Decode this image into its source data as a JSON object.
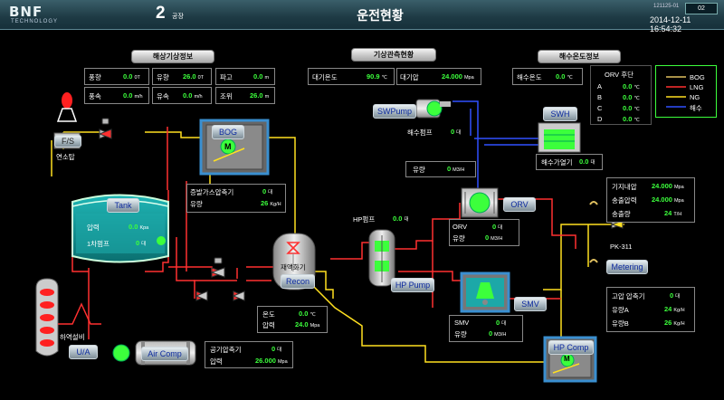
{
  "header": {
    "logo": "BNF",
    "logo_sub": "TECHNOLOGY",
    "plant_number": "2",
    "plant_label": "공장",
    "title": "운전현황",
    "system_id": "121125-01",
    "system_num": "02",
    "datetime": "2014-12-11  16:54:32"
  },
  "sections": {
    "sea_weather": "해상기상정보",
    "air_weather": "기상관측현황",
    "sea_temp": "해수온도정보"
  },
  "sea_weather": [
    {
      "label": "풍향",
      "value": "0.0",
      "unit": "0T"
    },
    {
      "label": "유향",
      "value": "26.0",
      "unit": "0T"
    },
    {
      "label": "파고",
      "value": "0.0",
      "unit": "m"
    },
    {
      "label": "풍속",
      "value": "0.0",
      "unit": "m/h"
    },
    {
      "label": "유속",
      "value": "0.0",
      "unit": "m/h"
    },
    {
      "label": "조위",
      "value": "26.0",
      "unit": "m"
    }
  ],
  "air_weather": [
    {
      "label": "대기온도",
      "value": "90.9",
      "unit": "℃"
    },
    {
      "label": "대기압",
      "value": "24.000",
      "unit": "Mpa"
    }
  ],
  "sea_temp": {
    "label": "해수온도",
    "value": "0.0",
    "unit": "℃"
  },
  "orv_temps": {
    "title": "ORV 후단",
    "rows": [
      {
        "label": "A",
        "value": "0.0",
        "unit": "℃"
      },
      {
        "label": "B",
        "value": "0.0",
        "unit": "℃"
      },
      {
        "label": "C",
        "value": "0.0",
        "unit": "℃"
      },
      {
        "label": "D",
        "value": "0.0",
        "unit": "℃"
      }
    ]
  },
  "legend": [
    {
      "label": "BOG",
      "color": "#e0c060"
    },
    {
      "label": "LNG",
      "color": "#ff3030"
    },
    {
      "label": "NG",
      "color": "#ffe020"
    },
    {
      "label": "해수",
      "color": "#3050ff"
    }
  ],
  "equipment": {
    "fs": "F/S",
    "flare": "연소탑",
    "bog": "BOG",
    "tank": "Tank",
    "recon_label": "재액화기",
    "recon": "Recon",
    "hp_pump": "HP Pump",
    "hp_pump_top": "HP펌프",
    "hp_pump_top_val": "0.0",
    "hp_pump_top_unit": "대",
    "swpump": "SWPump",
    "swh": "SWH",
    "orv": "ORV",
    "smv": "SMV",
    "hp_comp": "HP Comp",
    "air_comp": "Air Comp",
    "metering": "Metering",
    "pk": "PK-311",
    "unloading": "하역설비",
    "ua": "U/A",
    "motor": "M"
  },
  "tank_panel": [
    {
      "label": "압력",
      "value": "0.0",
      "unit": "Kpa"
    },
    {
      "label": "1차펌프",
      "value": "0",
      "unit": "대"
    }
  ],
  "bog_comp_panel": [
    {
      "label": "증발가스압축기",
      "value": "0",
      "unit": "대"
    },
    {
      "label": "유량",
      "value": "26",
      "unit": "Kg/H"
    }
  ],
  "seawater_pump": {
    "label": "해수펌프",
    "value": "0",
    "unit": "대"
  },
  "sw_flow": {
    "label": "유량",
    "value": "0",
    "unit": "M3/H"
  },
  "swh_panel": {
    "label": "해수가열기",
    "value": "0.0",
    "unit": "대"
  },
  "orv_panel": [
    {
      "label": "ORV",
      "value": "0",
      "unit": "대"
    },
    {
      "label": "유량",
      "value": "0",
      "unit": "M3/H"
    }
  ],
  "smv_panel": [
    {
      "label": "SMV",
      "value": "0",
      "unit": "대"
    },
    {
      "label": "유량",
      "value": "0",
      "unit": "M3/H"
    }
  ],
  "recon_panel": [
    {
      "label": "온도",
      "value": "0.0",
      "unit": "℃"
    },
    {
      "label": "압력",
      "value": "24.0",
      "unit": "Mpa"
    }
  ],
  "air_comp_panel": [
    {
      "label": "공기압축기",
      "value": "0",
      "unit": "대"
    },
    {
      "label": "압력",
      "value": "26.000",
      "unit": "Mpa"
    }
  ],
  "supply_panel": [
    {
      "label": "기지내압",
      "value": "24.000",
      "unit": "Mpa"
    },
    {
      "label": "송출압력",
      "value": "24.000",
      "unit": "Mpa"
    },
    {
      "label": "송출량",
      "value": "24",
      "unit": "T/H"
    }
  ],
  "hp_comp_panel": [
    {
      "label": "고압 압축기",
      "value": "0",
      "unit": "대"
    },
    {
      "label": "유량A",
      "value": "24",
      "unit": "Kg/H"
    },
    {
      "label": "유량B",
      "value": "26",
      "unit": "Kg/H"
    }
  ]
}
